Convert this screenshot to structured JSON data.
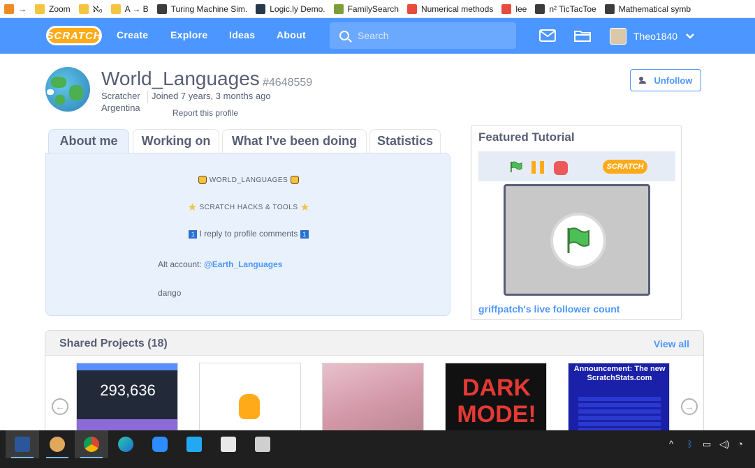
{
  "bookmarks": [
    {
      "label": "→",
      "icon": "orange-icon"
    },
    {
      "label": "Zoom",
      "icon": "folder-icon"
    },
    {
      "label": "ℵ₀",
      "icon": "folder-icon"
    },
    {
      "label": "A → B",
      "icon": "folder-icon"
    },
    {
      "label": "Turing Machine Sim.",
      "icon": "globe-icon"
    },
    {
      "label": "Logic.ly Demo.",
      "icon": "eye-icon"
    },
    {
      "label": "FamilySearch",
      "icon": "tree-icon"
    },
    {
      "label": "Numerical methods",
      "icon": "g-icon"
    },
    {
      "label": "lee",
      "icon": "red-icon"
    },
    {
      "label": "n² TicTacToe",
      "icon": "globe-icon"
    },
    {
      "label": "Mathematical symb",
      "icon": "globe-icon"
    }
  ],
  "navbar": {
    "logo": "SCRATCH",
    "links": [
      "Create",
      "Explore",
      "Ideas",
      "About"
    ],
    "search_placeholder": "Search",
    "username": "Theo1840"
  },
  "profile": {
    "username": "World_Languages",
    "id": "#4648559",
    "role": "Scratcher",
    "country": "Argentina",
    "joined": "Joined 7 years, 3 months ago",
    "report": "Report this profile",
    "unfollow": "Unfollow"
  },
  "tabs": [
    "About me",
    "Working on",
    "What I've been doing",
    "Statistics"
  ],
  "about": {
    "line1": "WORLD_LANGUAGES",
    "line2": "SCRATCH HACKS & TOOLS",
    "line3": "I reply to profile comments",
    "alt_prefix": "Alt account: ",
    "alt_link": "@Earth_Languages",
    "last": "dango",
    "badge_one": "1"
  },
  "featured": {
    "title": "Featured Tutorial",
    "mini_logo": "SCRATCH",
    "project_link": "griffpatch's live follower count"
  },
  "shared": {
    "title": "Shared Projects (18)",
    "view_all": "View all",
    "thumb1_number": "293,636",
    "thumb4_text": "DARK MODE!",
    "thumb5_text": "Announcement: The new ScratchStats.com"
  },
  "colors": {
    "navbar": "#4c97ff",
    "accent_orange": "#ffab19",
    "link": "#4c97ff",
    "text": "#575e75"
  }
}
